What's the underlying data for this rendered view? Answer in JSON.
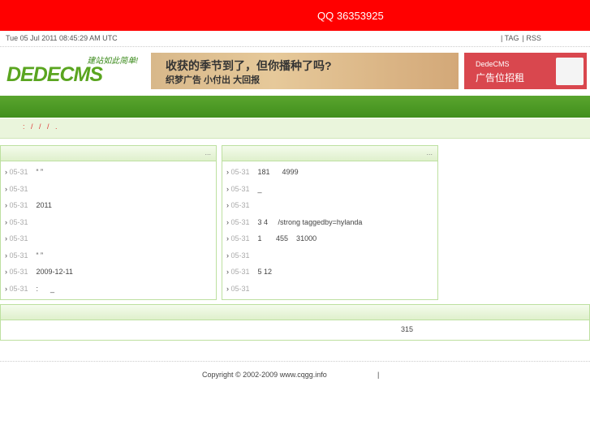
{
  "top": {
    "qq": "QQ 36353925"
  },
  "info": {
    "date": "Tue 05 Jul 2011 08:45:29 AM UTC",
    "links": [
      "| TAG",
      "| RSS"
    ]
  },
  "logo": {
    "text": "DEDECMS",
    "slogan": "建站如此简单!"
  },
  "banner": {
    "line1": "收获的季节到了，但你播种了吗?",
    "line2": "织梦广告 小付出 大回报"
  },
  "ad": {
    "line1": "DedeCMS",
    "line2": "广告位招租"
  },
  "breadcrumb": {
    "text": ":   /   /   /   ."
  },
  "left_box": {
    "more": "...",
    "items": [
      {
        "date": "05-31",
        "title": "“ ”"
      },
      {
        "date": "05-31",
        "title": ""
      },
      {
        "date": "05-31",
        "title": "2011"
      },
      {
        "date": "05-31",
        "title": ""
      },
      {
        "date": "05-31",
        "title": ""
      },
      {
        "date": "05-31",
        "title": "“ ”"
      },
      {
        "date": "05-31",
        "title": "2009-12-11"
      },
      {
        "date": "05-31",
        "title": ":      _"
      }
    ]
  },
  "right_box": {
    "more": "...",
    "items": [
      {
        "date": "05-31",
        "title": "181      4999"
      },
      {
        "date": "05-31",
        "title": "_"
      },
      {
        "date": "05-31",
        "title": ""
      },
      {
        "date": "05-31",
        "title": "3 4     /strong taggedby=hylanda"
      },
      {
        "date": "05-31",
        "title": "1       455    31000"
      },
      {
        "date": "05-31",
        "title": ""
      },
      {
        "date": "05-31",
        "title": "5 12"
      },
      {
        "date": "05-31",
        "title": ""
      }
    ]
  },
  "footer_box": {
    "text": "315"
  },
  "footer": {
    "copyright": "Copyright © 2002-2009 www.cqgg.info",
    "sep": "|"
  }
}
